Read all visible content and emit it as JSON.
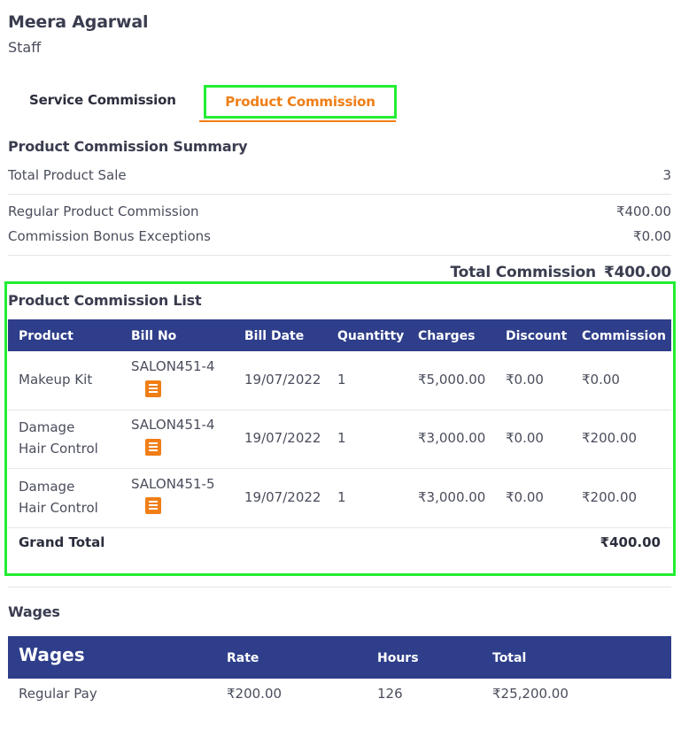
{
  "staff": {
    "name": "Meera Agarwal",
    "role": "Staff"
  },
  "tabs": {
    "service": "Service Commission",
    "product": "Product Commission"
  },
  "summary": {
    "title": "Product Commission Summary",
    "total_product_sale_label": "Total Product Sale",
    "total_product_sale_value": "3",
    "regular_label": "Regular Product Commission",
    "regular_value": "₹400.00",
    "bonus_label": "Commission Bonus Exceptions",
    "bonus_value": "₹0.00",
    "total_label": "Total Commission",
    "total_value": "₹400.00"
  },
  "list": {
    "title": "Product Commission List",
    "columns": [
      "Product",
      "Bill No",
      "Bill Date",
      "Quantitty",
      "Charges",
      "Discount",
      "Commission"
    ],
    "rows": [
      {
        "product": [
          "Makeup Kit"
        ],
        "bill_no": "SALON451-4",
        "bill_date": "19/07/2022",
        "quantity": "1",
        "charges": "₹5,000.00",
        "discount": "₹0.00",
        "commission": "₹0.00"
      },
      {
        "product": [
          "Damage",
          "Hair Control"
        ],
        "bill_no": "SALON451-4",
        "bill_date": "19/07/2022",
        "quantity": "1",
        "charges": "₹3,000.00",
        "discount": "₹0.00",
        "commission": "₹200.00"
      },
      {
        "product": [
          "Damage",
          "Hair Control"
        ],
        "bill_no": "SALON451-5",
        "bill_date": "19/07/2022",
        "quantity": "1",
        "charges": "₹3,000.00",
        "discount": "₹0.00",
        "commission": "₹200.00"
      }
    ],
    "grand_total_label": "Grand Total",
    "grand_total_value": "₹400.00",
    "bill_icon": "receipt-icon"
  },
  "wages": {
    "title": "Wages",
    "columns": [
      "Wages",
      "Rate",
      "Hours",
      "Total"
    ],
    "rows": [
      {
        "name": "Regular Pay",
        "rate": "₹200.00",
        "hours": "126",
        "total": "₹25,200.00"
      }
    ]
  },
  "colors": {
    "accent": "#f07e16",
    "header_bg": "#2e3e8a",
    "highlight": "#22ee33"
  }
}
